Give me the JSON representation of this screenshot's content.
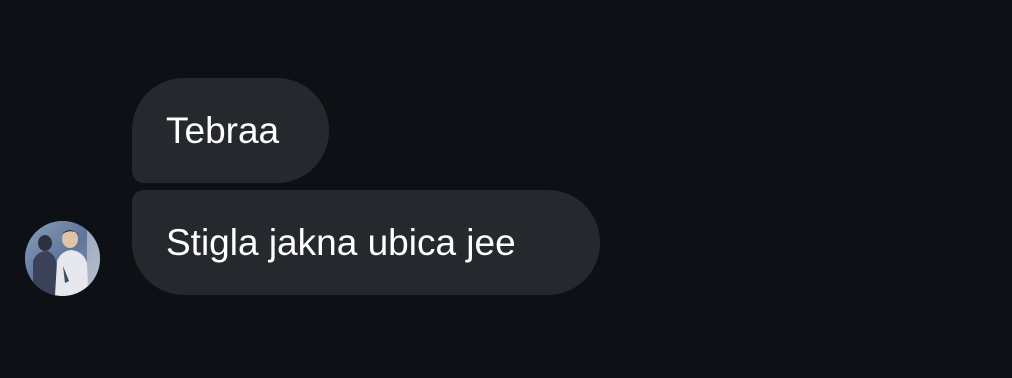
{
  "colors": {
    "background": "#0d1116",
    "bubble": "#25282c",
    "text": "#ffffff"
  },
  "conversation": {
    "avatar_icon": "user-avatar-photo",
    "messages": [
      {
        "text": "Tebraa"
      },
      {
        "text": "Stigla jakna ubica jee"
      }
    ]
  }
}
